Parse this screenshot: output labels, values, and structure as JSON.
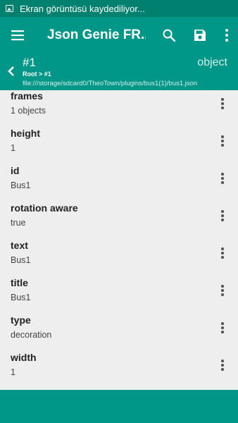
{
  "status_bar": {
    "text": "Ekran görüntüsü kaydediliyor..."
  },
  "app_bar": {
    "title": "Json Genie FR...",
    "icons": {
      "menu": "hamburger-menu-icon",
      "search": "search-icon",
      "save": "save-icon",
      "more": "more-vert-icon"
    }
  },
  "node": {
    "name": "#1",
    "type": "object",
    "breadcrumb": "Root > #1",
    "file_path": "file:///storage/sdcard0/TheoTown/plugins/bus1(1)/bus1.json"
  },
  "items": [
    {
      "key": "frames",
      "value": "1 objects"
    },
    {
      "key": "height",
      "value": "1"
    },
    {
      "key": "id",
      "value": "Bus1"
    },
    {
      "key": "rotation aware",
      "value": "true"
    },
    {
      "key": "text",
      "value": "Bus1"
    },
    {
      "key": "title",
      "value": "Bus1"
    },
    {
      "key": "type",
      "value": "decoration"
    },
    {
      "key": "width",
      "value": "1"
    }
  ],
  "colors": {
    "primary": "#009688",
    "primary_dark": "#00806f",
    "background": "#eeeeee"
  }
}
